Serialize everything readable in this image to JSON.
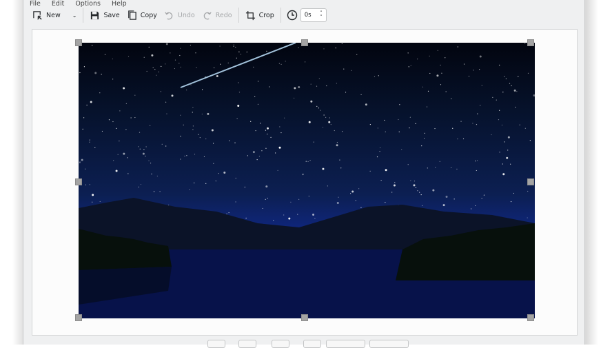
{
  "menu": [
    "File",
    "Edit",
    "Options",
    "Help"
  ],
  "toolbar": {
    "new": "New",
    "save": "Save",
    "copy": "Copy",
    "undo": "Undo",
    "redo": "Redo",
    "crop": "Crop",
    "delay": "0s"
  },
  "colors": {
    "window": "#eff0f1",
    "disabled": "#a5a7a9"
  }
}
